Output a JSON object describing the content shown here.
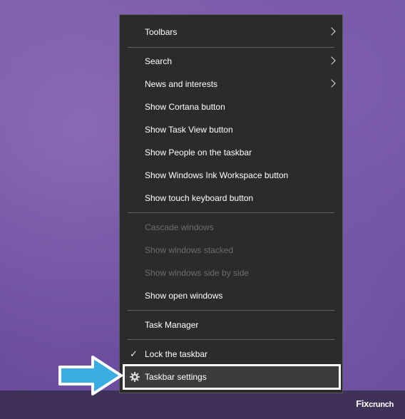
{
  "menu": {
    "toolbars": "Toolbars",
    "search": "Search",
    "news": "News and interests",
    "cortana": "Show Cortana button",
    "taskview": "Show Task View button",
    "people": "Show People on the taskbar",
    "ink": "Show Windows Ink Workspace button",
    "touch_keyboard": "Show touch keyboard button",
    "cascade": "Cascade windows",
    "stacked": "Show windows stacked",
    "side_by_side": "Show windows side by side",
    "open_windows": "Show open windows",
    "task_manager": "Task Manager",
    "lock": "Lock the taskbar",
    "taskbar_settings": "Taskbar settings"
  },
  "icons": {
    "submenu": "chevron-right-icon",
    "check": "checkmark-icon",
    "settings": "gear-icon",
    "pointer": "arrow-right-icon"
  },
  "watermark": {
    "brand_prefix": "Fix",
    "brand_suffix": "crunch"
  },
  "colors": {
    "menu_bg": "#2b2b2b",
    "text": "#ffffff",
    "disabled_text": "#6d6d6d",
    "arrow": "#3aaee0"
  }
}
